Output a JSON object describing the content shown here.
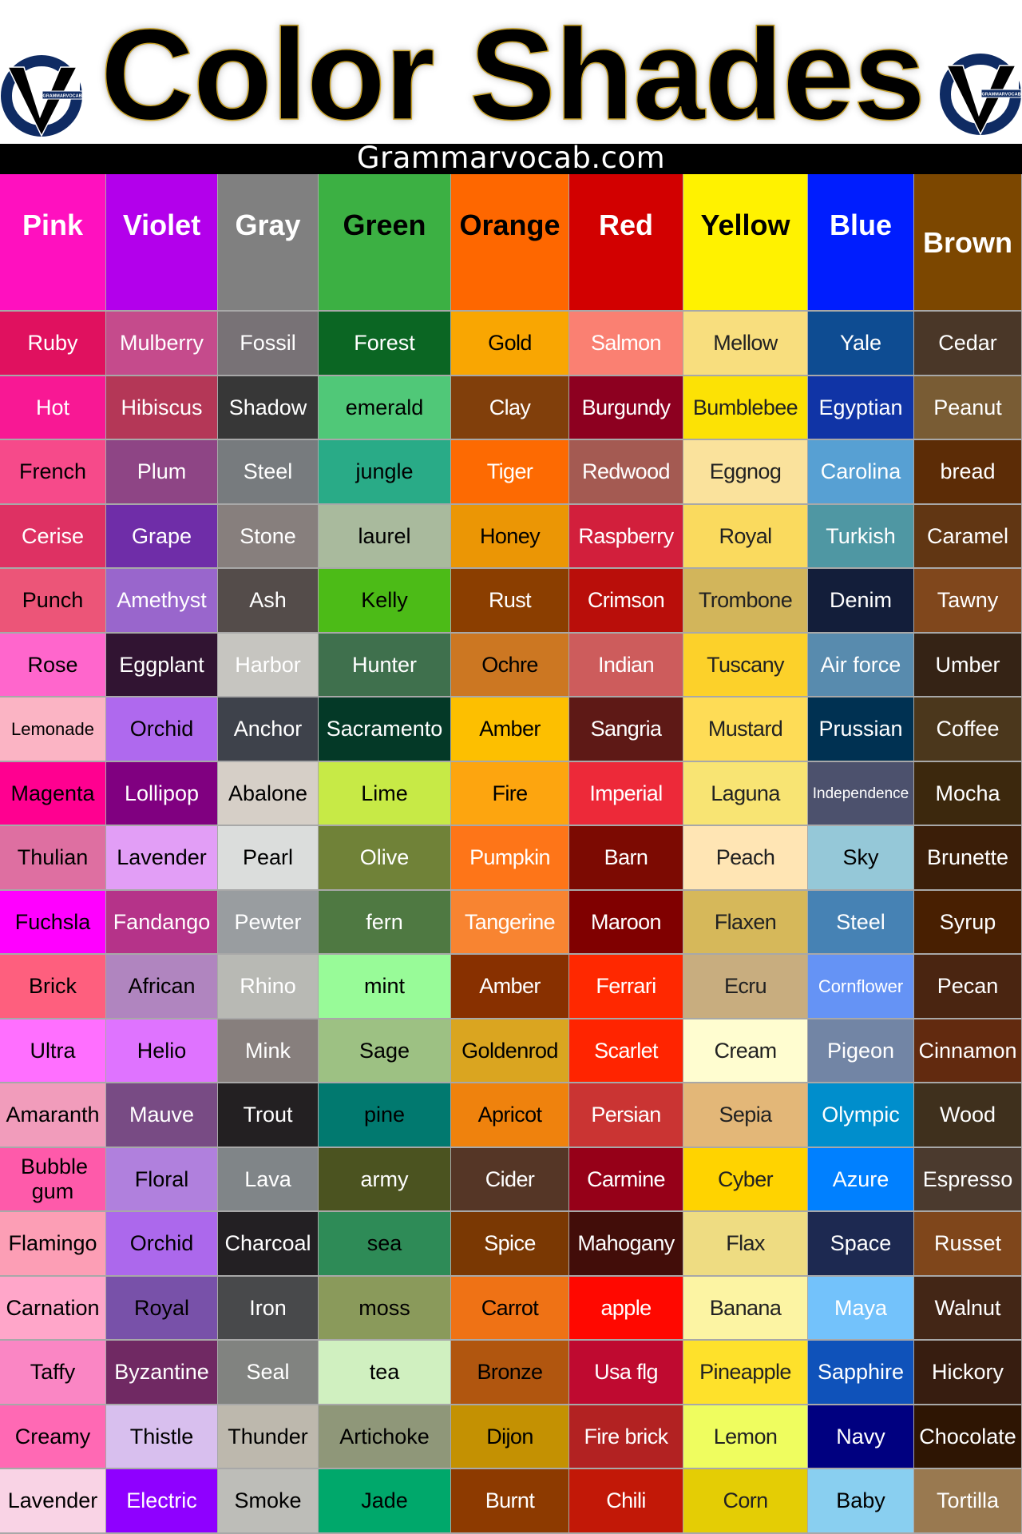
{
  "title": "Color Shades",
  "subtitle": "Grammarvocab.com",
  "logo": {
    "text": "GRAMMARVOCAB",
    "ring_color": "#0f2b63",
    "v_color": "#000000"
  },
  "columns": [
    {
      "name": "Pink",
      "color": "#ff10bf",
      "text": "#ffffff",
      "shades": [
        {
          "name": "Ruby",
          "color": "#e0115f",
          "text": "#ffffff"
        },
        {
          "name": "Hot",
          "color": "#f81894",
          "text": "#ffffff"
        },
        {
          "name": "French",
          "color": "#f64a8a",
          "text": "#000000"
        },
        {
          "name": "Cerise",
          "color": "#de3163",
          "text": "#ffffff"
        },
        {
          "name": "Punch",
          "color": "#ec5578",
          "text": "#000000"
        },
        {
          "name": "Rose",
          "color": "#ff66cc",
          "text": "#000000"
        },
        {
          "name": "Lemonade",
          "color": "#fbb4c4",
          "text": "#000000"
        },
        {
          "name": "Magenta",
          "color": "#ff0090",
          "text": "#000000"
        },
        {
          "name": "Thulian",
          "color": "#de6fa1",
          "text": "#000000"
        },
        {
          "name": "Fuchsla",
          "color": "#ff00ff",
          "text": "#000000"
        },
        {
          "name": "Brick",
          "color": "#fe5f7e",
          "text": "#000000"
        },
        {
          "name": "Ultra",
          "color": "#ff6fff",
          "text": "#000000"
        },
        {
          "name": "Amaranth",
          "color": "#f19cbb",
          "text": "#000000"
        },
        {
          "name": "Bubble gum",
          "color": "#fe5aaa",
          "text": "#000000"
        },
        {
          "name": "Flamingo",
          "color": "#fc9eb5",
          "text": "#000000"
        },
        {
          "name": "Carnation",
          "color": "#ffa6c9",
          "text": "#000000"
        },
        {
          "name": "Taffy",
          "color": "#fa86c4",
          "text": "#000000"
        },
        {
          "name": "Creamy",
          "color": "#ff69b4",
          "text": "#000000"
        },
        {
          "name": "Lavender",
          "color": "#f9d3e5",
          "text": "#000000"
        }
      ]
    },
    {
      "name": "Violet",
      "color": "#b300eb",
      "text": "#ffffff",
      "shades": [
        {
          "name": "Mulberry",
          "color": "#c54b8c",
          "text": "#ffffff"
        },
        {
          "name": "Hibiscus",
          "color": "#b43757",
          "text": "#ffffff"
        },
        {
          "name": "Plum",
          "color": "#8e4585",
          "text": "#ffffff"
        },
        {
          "name": "Grape",
          "color": "#6f2da8",
          "text": "#ffffff"
        },
        {
          "name": "Amethyst",
          "color": "#9966cc",
          "text": "#ffffff"
        },
        {
          "name": "Eggplant",
          "color": "#311432",
          "text": "#ffffff"
        },
        {
          "name": "Orchid",
          "color": "#af69ee",
          "text": "#000000"
        },
        {
          "name": "Lollipop",
          "color": "#800080",
          "text": "#ffffff"
        },
        {
          "name": "Lavender",
          "color": "#e29ef6",
          "text": "#000000"
        },
        {
          "name": "Fandango",
          "color": "#b53389",
          "text": "#ffffff"
        },
        {
          "name": "African",
          "color": "#b085bf",
          "text": "#000000"
        },
        {
          "name": "Helio",
          "color": "#df73ff",
          "text": "#000000"
        },
        {
          "name": "Mauve",
          "color": "#784b84",
          "text": "#ffffff"
        },
        {
          "name": "Floral",
          "color": "#b080dd",
          "text": "#000000"
        },
        {
          "name": "Orchid",
          "color": "#ac68ec",
          "text": "#000000"
        },
        {
          "name": "Royal",
          "color": "#7851a9",
          "text": "#000000"
        },
        {
          "name": "Byzantine",
          "color": "#702963",
          "text": "#ffffff"
        },
        {
          "name": "Thistle",
          "color": "#d8bfee",
          "text": "#000000"
        },
        {
          "name": "Electric",
          "color": "#8f00ff",
          "text": "#ffffff"
        }
      ]
    },
    {
      "name": "Gray",
      "color": "#808080",
      "text": "#ffffff",
      "shades": [
        {
          "name": "Fossil",
          "color": "#787276",
          "text": "#ffffff"
        },
        {
          "name": "Shadow",
          "color": "#373737",
          "text": "#ffffff"
        },
        {
          "name": "Steel",
          "color": "#777b7e",
          "text": "#ffffff"
        },
        {
          "name": "Stone",
          "color": "#877f7d",
          "text": "#ffffff"
        },
        {
          "name": "Ash",
          "color": "#544c4a",
          "text": "#ffffff"
        },
        {
          "name": "Harbor",
          "color": "#c6c5c0",
          "text": "#ffffff"
        },
        {
          "name": "Anchor",
          "color": "#3e424b",
          "text": "#ffffff"
        },
        {
          "name": "Abalone",
          "color": "#d6cfc7",
          "text": "#000000"
        },
        {
          "name": "Pearl",
          "color": "#dbdddc",
          "text": "#000000"
        },
        {
          "name": "Pewter",
          "color": "#999da0",
          "text": "#ffffff"
        },
        {
          "name": "Rhino",
          "color": "#b8b9b4",
          "text": "#ffffff"
        },
        {
          "name": "Mink",
          "color": "#877f7d",
          "text": "#ffffff"
        },
        {
          "name": "Trout",
          "color": "#232022",
          "text": "#ffffff"
        },
        {
          "name": "Lava",
          "color": "#808588",
          "text": "#ffffff"
        },
        {
          "name": "Charcoal",
          "color": "#232023",
          "text": "#ffffff"
        },
        {
          "name": "Iron",
          "color": "#48494b",
          "text": "#ffffff"
        },
        {
          "name": "Seal",
          "color": "#818380",
          "text": "#ffffff"
        },
        {
          "name": "Thunder",
          "color": "#bdb8ad",
          "text": "#000000"
        },
        {
          "name": "Smoke",
          "color": "#bdbdb8",
          "text": "#000000"
        }
      ]
    },
    {
      "name": "Green",
      "color": "#3cb043",
      "text": "#000000",
      "shades": [
        {
          "name": "Forest",
          "color": "#0b6623",
          "text": "#ffffff"
        },
        {
          "name": "emerald",
          "color": "#50c878",
          "text": "#000000"
        },
        {
          "name": "jungle",
          "color": "#29ab87",
          "text": "#000000"
        },
        {
          "name": "laurel",
          "color": "#a9ba9d",
          "text": "#000000"
        },
        {
          "name": "Kelly",
          "color": "#4cbb17",
          "text": "#000000"
        },
        {
          "name": "Hunter",
          "color": "#3f704d",
          "text": "#ffffff"
        },
        {
          "name": "Sacramento",
          "color": "#043927",
          "text": "#ffffff"
        },
        {
          "name": "Lime",
          "color": "#c7ea46",
          "text": "#000000"
        },
        {
          "name": "Olive",
          "color": "#708238",
          "text": "#ffffff"
        },
        {
          "name": "fern",
          "color": "#4f7942",
          "text": "#ffffff"
        },
        {
          "name": "mint",
          "color": "#98fb98",
          "text": "#000000"
        },
        {
          "name": "Sage",
          "color": "#9dc183",
          "text": "#000000"
        },
        {
          "name": "pine",
          "color": "#01796f",
          "text": "#000000"
        },
        {
          "name": "army",
          "color": "#4b5320",
          "text": "#ffffff"
        },
        {
          "name": "sea",
          "color": "#2e8b57",
          "text": "#000000"
        },
        {
          "name": "moss",
          "color": "#8a9a5b",
          "text": "#000000"
        },
        {
          "name": "tea",
          "color": "#d0f0c0",
          "text": "#000000"
        },
        {
          "name": "Artichoke",
          "color": "#8f9779",
          "text": "#000000"
        },
        {
          "name": "Jade",
          "color": "#00a86b",
          "text": "#000000"
        }
      ]
    },
    {
      "name": "Orange",
      "color": "#fe6700",
      "text": "#000000",
      "shades": [
        {
          "name": "Gold",
          "color": "#f9a602",
          "text": "#000000"
        },
        {
          "name": "Clay",
          "color": "#813f0b",
          "text": "#ffffff"
        },
        {
          "name": "Tiger",
          "color": "#fd6a02",
          "text": "#ffffff"
        },
        {
          "name": "Honey",
          "color": "#eb9605",
          "text": "#000000"
        },
        {
          "name": "Rust",
          "color": "#8b3e00",
          "text": "#ffffff"
        },
        {
          "name": "Ochre",
          "color": "#cc7722",
          "text": "#000000"
        },
        {
          "name": "Amber",
          "color": "#fdbf00",
          "text": "#000000"
        },
        {
          "name": "Fire",
          "color": "#fda50f",
          "text": "#000000"
        },
        {
          "name": "Pumpkin",
          "color": "#fe7518",
          "text": "#ffffff"
        },
        {
          "name": "Tangerine",
          "color": "#f88431",
          "text": "#ffffff"
        },
        {
          "name": "Amber",
          "color": "#883000",
          "text": "#ffffff"
        },
        {
          "name": "Goldenrod",
          "color": "#daa520",
          "text": "#000000"
        },
        {
          "name": "Apricot",
          "color": "#ef820d",
          "text": "#000000"
        },
        {
          "name": "Cider",
          "color": "#553626",
          "text": "#ffffff"
        },
        {
          "name": "Spice",
          "color": "#7a3803",
          "text": "#ffffff"
        },
        {
          "name": "Carrot",
          "color": "#ef7215",
          "text": "#000000"
        },
        {
          "name": "Bronze",
          "color": "#b1560f",
          "text": "#000000"
        },
        {
          "name": "Dijon",
          "color": "#c49102",
          "text": "#000000"
        },
        {
          "name": "Burnt",
          "color": "#8d3a00",
          "text": "#ffffff"
        }
      ]
    },
    {
      "name": "Red",
      "color": "#d20000",
      "text": "#ffffff",
      "shades": [
        {
          "name": "Salmon",
          "color": "#fa8072",
          "text": "#ffffff"
        },
        {
          "name": "Burgundy",
          "color": "#8d0020",
          "text": "#ffffff"
        },
        {
          "name": "Redwood",
          "color": "#a45a52",
          "text": "#ffffff"
        },
        {
          "name": "Raspberry",
          "color": "#d21f3c",
          "text": "#ffffff"
        },
        {
          "name": "Crimson",
          "color": "#b90e0a",
          "text": "#ffffff"
        },
        {
          "name": "Indian",
          "color": "#cd5c5c",
          "text": "#ffffff"
        },
        {
          "name": "Sangria",
          "color": "#5e1916",
          "text": "#ffffff"
        },
        {
          "name": "Imperial",
          "color": "#ed2939",
          "text": "#ffffff"
        },
        {
          "name": "Barn",
          "color": "#7c0a02",
          "text": "#ffffff"
        },
        {
          "name": "Maroon",
          "color": "#800000",
          "text": "#ffffff"
        },
        {
          "name": "Ferrari",
          "color": "#ff2800",
          "text": "#ffffff"
        },
        {
          "name": "Scarlet",
          "color": "#ff2400",
          "text": "#ffffff"
        },
        {
          "name": "Persian",
          "color": "#ca3433",
          "text": "#ffffff"
        },
        {
          "name": "Carmine",
          "color": "#960018",
          "text": "#ffffff"
        },
        {
          "name": "Mahogany",
          "color": "#420d09",
          "text": "#ffffff"
        },
        {
          "name": "apple",
          "color": "#ff0800",
          "text": "#ffffff"
        },
        {
          "name": "Usa flg",
          "color": "#bf0a30",
          "text": "#ffffff"
        },
        {
          "name": "Fire brick",
          "color": "#b22222",
          "text": "#ffffff"
        },
        {
          "name": "Chili",
          "color": "#c21807",
          "text": "#ffffff"
        }
      ]
    },
    {
      "name": "Yellow",
      "color": "#fff200",
      "text": "#000000",
      "shades": [
        {
          "name": "Mellow",
          "color": "#f8de7e",
          "text": "#222222"
        },
        {
          "name": "Bumblebee",
          "color": "#fce205",
          "text": "#222222"
        },
        {
          "name": "Eggnog",
          "color": "#fae29c",
          "text": "#222222"
        },
        {
          "name": "Royal",
          "color": "#fada5e",
          "text": "#222222"
        },
        {
          "name": "Trombone",
          "color": "#d2b55b",
          "text": "#222222"
        },
        {
          "name": "Tuscany",
          "color": "#fcd12a",
          "text": "#222222"
        },
        {
          "name": "Mustard",
          "color": "#fedc56",
          "text": "#222222"
        },
        {
          "name": "Laguna",
          "color": "#f8e473",
          "text": "#222222"
        },
        {
          "name": "Peach",
          "color": "#ffe5b4",
          "text": "#222222"
        },
        {
          "name": "Flaxen",
          "color": "#d6b85a",
          "text": "#222222"
        },
        {
          "name": "Ecru",
          "color": "#c8ad7f",
          "text": "#222222"
        },
        {
          "name": "Cream",
          "color": "#fffdd0",
          "text": "#222222"
        },
        {
          "name": "Sepia",
          "color": "#e3b778",
          "text": "#222222"
        },
        {
          "name": "Cyber",
          "color": "#ffd300",
          "text": "#222222"
        },
        {
          "name": "Flax",
          "color": "#eedc82",
          "text": "#222222"
        },
        {
          "name": "Banana",
          "color": "#fcf4a3",
          "text": "#222222"
        },
        {
          "name": "Pineapple",
          "color": "#fee12b",
          "text": "#222222"
        },
        {
          "name": "Lemon",
          "color": "#effd5f",
          "text": "#222222"
        },
        {
          "name": "Corn",
          "color": "#e4cd05",
          "text": "#222222"
        }
      ]
    },
    {
      "name": "Blue",
      "color": "#001dfe",
      "text": "#ffffff",
      "shades": [
        {
          "name": "Yale",
          "color": "#0e4c92",
          "text": "#ffffff"
        },
        {
          "name": "Egyptian",
          "color": "#1034a6",
          "text": "#ffffff"
        },
        {
          "name": "Carolina",
          "color": "#57a0d3",
          "text": "#ffffff"
        },
        {
          "name": "Turkish",
          "color": "#4f97a3",
          "text": "#ffffff"
        },
        {
          "name": "Denim",
          "color": "#131e3a",
          "text": "#ffffff"
        },
        {
          "name": "Air force",
          "color": "#588bae",
          "text": "#ffffff"
        },
        {
          "name": "Prussian",
          "color": "#003152",
          "text": "#ffffff"
        },
        {
          "name": "Independence",
          "color": "#4c516d",
          "text": "#ffffff"
        },
        {
          "name": "Sky",
          "color": "#95c8d8",
          "text": "#000000"
        },
        {
          "name": "Steel",
          "color": "#4682b4",
          "text": "#ffffff"
        },
        {
          "name": "Cornflower",
          "color": "#6593f5",
          "text": "#ffffff"
        },
        {
          "name": "Pigeon",
          "color": "#7285a5",
          "text": "#ffffff"
        },
        {
          "name": "Olympic",
          "color": "#008ecc",
          "text": "#ffffff"
        },
        {
          "name": "Azure",
          "color": "#0080ff",
          "text": "#ffffff"
        },
        {
          "name": "Space",
          "color": "#1d2951",
          "text": "#ffffff"
        },
        {
          "name": "Maya",
          "color": "#73c2fb",
          "text": "#ffffff"
        },
        {
          "name": "Sapphire",
          "color": "#0f52ba",
          "text": "#ffffff"
        },
        {
          "name": "Navy",
          "color": "#000080",
          "text": "#ffffff"
        },
        {
          "name": "Baby",
          "color": "#89cff0",
          "text": "#000000"
        }
      ]
    },
    {
      "name": "Brown",
      "color": "#7c4700",
      "text": "#ffffff",
      "shades": [
        {
          "name": "Cedar",
          "color": "#4a3728",
          "text": "#ffffff"
        },
        {
          "name": "Peanut",
          "color": "#795c34",
          "text": "#ffffff"
        },
        {
          "name": "bread",
          "color": "#5c2c06",
          "text": "#ffffff"
        },
        {
          "name": "Caramel",
          "color": "#613613",
          "text": "#ffffff"
        },
        {
          "name": "Tawny",
          "color": "#80471c",
          "text": "#ffffff"
        },
        {
          "name": "Umber",
          "color": "#352315",
          "text": "#ffffff"
        },
        {
          "name": "Coffee",
          "color": "#4b371c",
          "text": "#ffffff"
        },
        {
          "name": "Mocha",
          "color": "#3c280d",
          "text": "#ffffff"
        },
        {
          "name": "Brunette",
          "color": "#3b1e08",
          "text": "#ffffff"
        },
        {
          "name": "Syrup",
          "color": "#481f01",
          "text": "#ffffff"
        },
        {
          "name": "Pecan",
          "color": "#4a2511",
          "text": "#ffffff"
        },
        {
          "name": "Cinnamon",
          "color": "#622a0f",
          "text": "#ffffff"
        },
        {
          "name": "Wood",
          "color": "#3f301d",
          "text": "#ffffff"
        },
        {
          "name": "Espresso",
          "color": "#4b3a2e",
          "text": "#ffffff"
        },
        {
          "name": "Russet",
          "color": "#7f461b",
          "text": "#ffffff"
        },
        {
          "name": "Walnut",
          "color": "#432616",
          "text": "#ffffff"
        },
        {
          "name": "Hickory",
          "color": "#371d10",
          "text": "#ffffff"
        },
        {
          "name": "Chocolate",
          "color": "#2e1503",
          "text": "#ffffff"
        },
        {
          "name": "Tortilla",
          "color": "#997950",
          "text": "#ffffff"
        }
      ]
    }
  ]
}
